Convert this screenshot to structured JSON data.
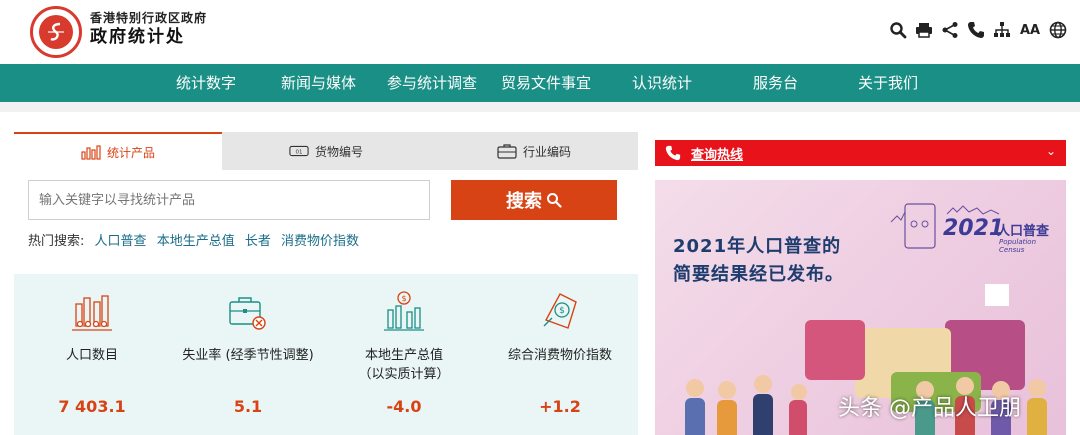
{
  "header": {
    "org_line1": "香港特别行政区政府",
    "org_line2": "政府统计处",
    "tools": [
      {
        "icon": "search-icon"
      },
      {
        "icon": "print-icon"
      },
      {
        "icon": "share-icon"
      },
      {
        "icon": "phone-icon"
      },
      {
        "icon": "sitemap-icon"
      },
      {
        "icon": "font-size-icon",
        "label": "AA"
      },
      {
        "icon": "globe-icon"
      }
    ]
  },
  "nav": {
    "items": [
      "统计数字",
      "新闻与媒体",
      "参与统计调查",
      "贸易文件事宜",
      "认识统计",
      "服务台",
      "关于我们"
    ]
  },
  "tabs": [
    {
      "label": "统计产品",
      "icon": "stat-product-icon",
      "active": true
    },
    {
      "label": "货物编号",
      "icon": "goods-code-icon",
      "active": false
    },
    {
      "label": "行业编码",
      "icon": "industry-code-icon",
      "active": false
    }
  ],
  "search": {
    "placeholder": "输入关键字以寻找统计产品",
    "button_label": "搜索"
  },
  "hot_search": {
    "label": "热门搜索:",
    "terms": [
      "人口普查",
      "本地生产总值",
      "长者",
      "消费物价指数"
    ]
  },
  "stats": [
    {
      "label_line1": "人口数目",
      "label_line2": "",
      "value": "7 403.1",
      "icon": "population-icon"
    },
    {
      "label_line1": "失业率 (经季节性调整)",
      "label_line2": "",
      "value": "5.1",
      "icon": "briefcase-icon"
    },
    {
      "label_line1": "本地生产总值",
      "label_line2": "（以实质计算）",
      "value": "-4.0",
      "icon": "gdp-icon"
    },
    {
      "label_line1": "综合消费物价指数",
      "label_line2": "",
      "value": "+1.2",
      "icon": "price-tag-icon"
    }
  ],
  "hotline": {
    "label": "查询热线"
  },
  "banner": {
    "line1": "2021年人口普查的",
    "line2": "简要结果经已发布。",
    "logo_year": "2021",
    "logo_zh": "人口普查",
    "logo_en": "Population Census"
  },
  "watermark": "头条 @产品人卫朋",
  "colors": {
    "teal": "#1a8f86",
    "accent": "#d84315",
    "hotline_red": "#e8131a"
  }
}
